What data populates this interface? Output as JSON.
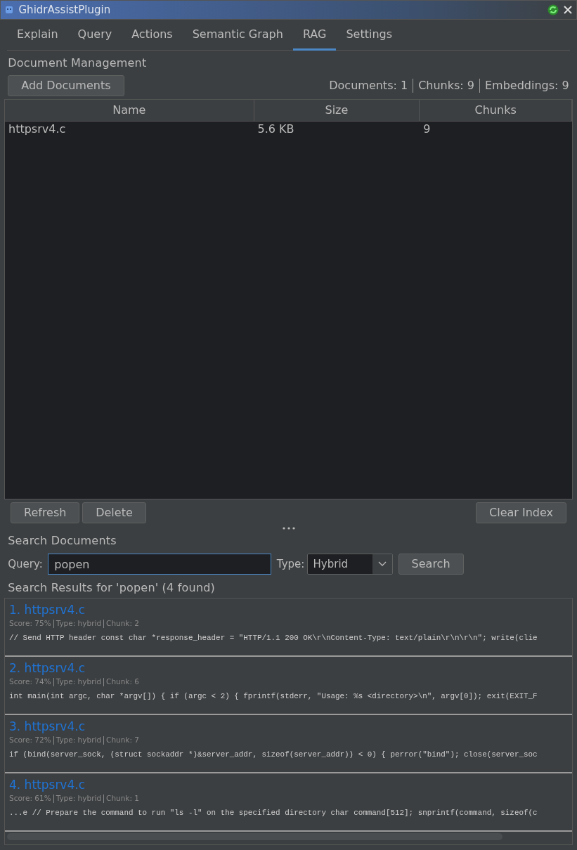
{
  "window": {
    "title": "GhidrAssistPlugin"
  },
  "tabs": [
    {
      "label": "Explain",
      "selected": false
    },
    {
      "label": "Query",
      "selected": false
    },
    {
      "label": "Actions",
      "selected": false
    },
    {
      "label": "Semantic Graph",
      "selected": false
    },
    {
      "label": "RAG",
      "selected": true
    },
    {
      "label": "Settings",
      "selected": false
    }
  ],
  "document_management": {
    "heading": "Document Management",
    "add_button": "Add Documents",
    "stats": [
      "Documents: 1",
      "Chunks: 9",
      "Embeddings: 9"
    ],
    "table": {
      "columns": [
        "Name",
        "Size",
        "Chunks"
      ],
      "rows": [
        [
          "httpsrv4.c",
          "5.6 KB",
          "9"
        ]
      ]
    },
    "buttons": [
      "Refresh",
      "Delete"
    ],
    "clear_button": "Clear Index"
  },
  "search": {
    "heading": "Search Documents",
    "query_label": "Query:",
    "query_value": "popen",
    "type_label": "Type:",
    "type_value": "Hybrid",
    "search_button": "Search",
    "results_heading": "Search Results for 'popen' (4 found)",
    "results": [
      {
        "title": "1. httpsrv4.c",
        "meta": [
          "Score: 75%",
          "Type: hybrid",
          "Chunk: 2"
        ],
        "snippet": "// Send HTTP header const char *response_header = \"HTTP/1.1 200 OK\\r\\nContent-Type: text/plain\\r\\n\\r\\n\"; write(clie"
      },
      {
        "title": "2. httpsrv4.c",
        "meta": [
          "Score: 74%",
          "Type: hybrid",
          "Chunk: 6"
        ],
        "snippet": "int main(int argc, char *argv[]) { if (argc < 2) { fprintf(stderr, \"Usage: %s <directory>\\n\", argv[0]); exit(EXIT_F"
      },
      {
        "title": "3. httpsrv4.c",
        "meta": [
          "Score: 72%",
          "Type: hybrid",
          "Chunk: 7"
        ],
        "snippet": "if (bind(server_sock, (struct sockaddr *)&server_addr, sizeof(server_addr)) < 0) { perror(\"bind\"); close(server_soc"
      },
      {
        "title": "4. httpsrv4.c",
        "meta": [
          "Score: 61%",
          "Type: hybrid",
          "Chunk: 1"
        ],
        "snippet": "...e // Prepare the command to run \"ls -l\" on the specified directory char command[512]; snprintf(command, sizeof(c"
      }
    ]
  }
}
